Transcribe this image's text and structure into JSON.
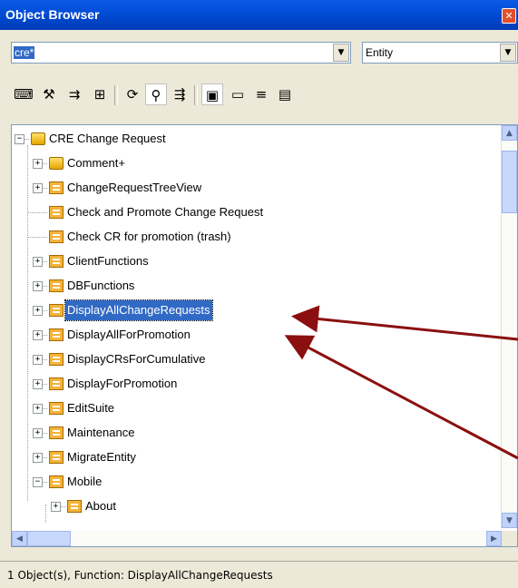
{
  "window": {
    "title": "Object Browser",
    "close_glyph": "✕"
  },
  "filter": {
    "search_value": "cre*",
    "type_value": "Entity"
  },
  "toolbar": {
    "icons": [
      "open-icon",
      "properties-icon",
      "hierarchy-icon",
      "relations-icon",
      "refresh-icon",
      "find-icon",
      "expand-icon",
      "entity-filter-icon",
      "field-filter-icon",
      "function-filter-icon",
      "view-filter-icon"
    ]
  },
  "tree": {
    "items": [
      {
        "label": "CRE Change Request",
        "icon": "entity-icon",
        "expander": "−"
      },
      {
        "label": "Comment+",
        "icon": "entity-icon",
        "expander": "+"
      },
      {
        "label": "ChangeRequestTreeView",
        "icon": "function-icon",
        "expander": "+"
      },
      {
        "label": "Check and Promote Change Request",
        "icon": "function-icon",
        "expander": ""
      },
      {
        "label": "Check CR for promotion (trash)",
        "icon": "function-icon",
        "expander": ""
      },
      {
        "label": "ClientFunctions",
        "icon": "function-icon",
        "expander": "+"
      },
      {
        "label": "DBFunctions",
        "icon": "function-icon",
        "expander": "+"
      },
      {
        "label": "DisplayAllChangeRequests",
        "icon": "function-icon",
        "expander": "+",
        "selected": true
      },
      {
        "label": "DisplayAllForPromotion",
        "icon": "function-icon",
        "expander": "+"
      },
      {
        "label": "DisplayCRsForCumulative",
        "icon": "function-icon",
        "expander": "+"
      },
      {
        "label": "DisplayForPromotion",
        "icon": "function-icon",
        "expander": "+"
      },
      {
        "label": "EditSuite",
        "icon": "function-icon",
        "expander": "+"
      },
      {
        "label": "Maintenance",
        "icon": "function-icon",
        "expander": "+"
      },
      {
        "label": "MigrateEntity",
        "icon": "function-icon",
        "expander": "+"
      },
      {
        "label": "Mobile",
        "icon": "function-icon",
        "expander": "−"
      },
      {
        "label": "About",
        "icon": "function-icon",
        "expander": "+"
      }
    ]
  },
  "status": {
    "text": "1 Object(s), Function: DisplayAllChangeRequests"
  },
  "colors": {
    "selection": "#316ac5",
    "title_bar": "#0048d0",
    "arrow": "#8b0f0f"
  }
}
